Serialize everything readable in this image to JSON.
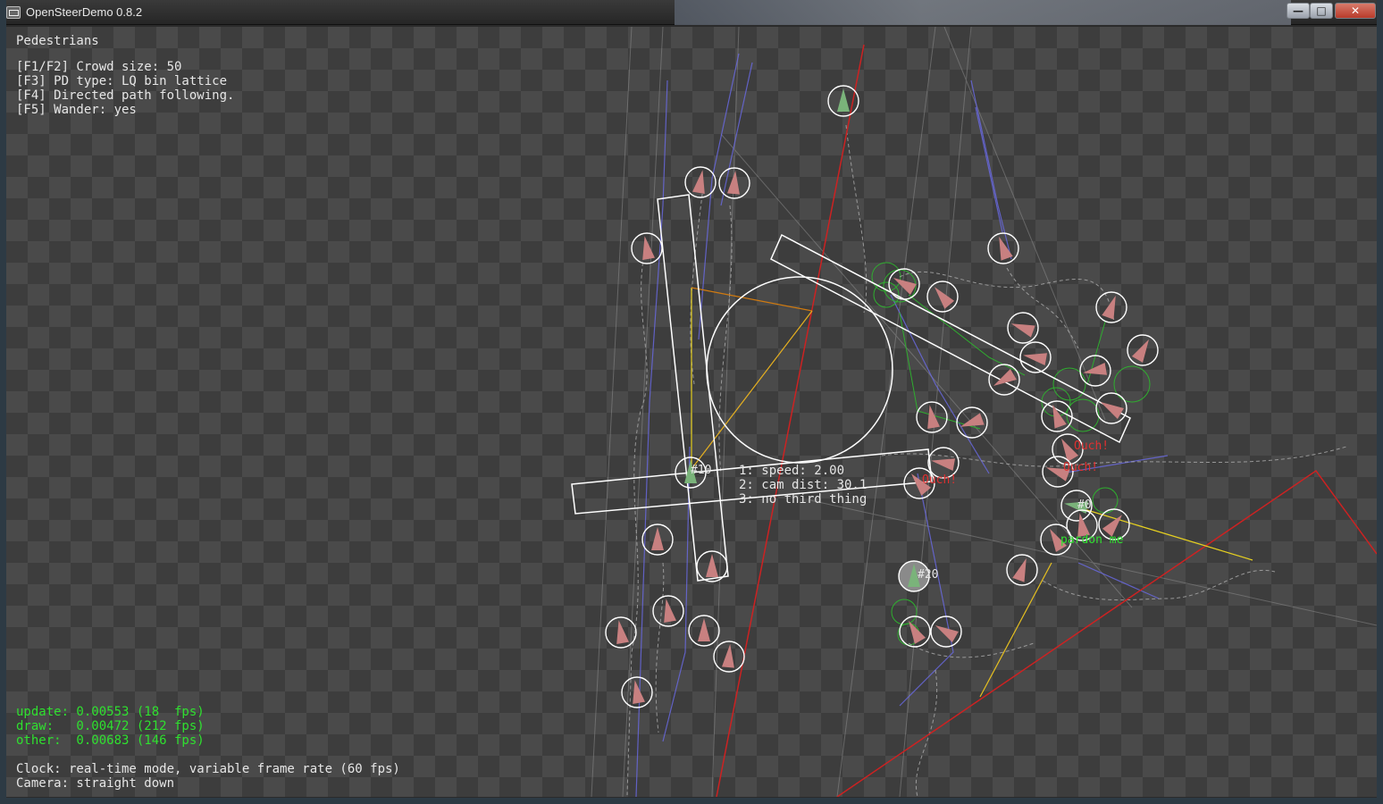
{
  "window": {
    "title": "OpenSteerDemo 0.8.2",
    "buttons": {
      "minimize": "—",
      "maximize": "□",
      "close": "✕"
    }
  },
  "hud": {
    "demo_name": "Pedestrians",
    "options": [
      "[F1/F2] Crowd size: 50",
      "[F3] PD type: LQ bin lattice",
      "[F4] Directed path following.",
      "[F5] Wander: yes"
    ],
    "timing": [
      "update: 0.00553 (18  fps)",
      "draw:   0.00472 (212 fps)",
      "other:  0.00683 (146 fps)"
    ],
    "clock": "Clock: real-time mode, variable frame rate (60 fps)",
    "camera": "Camera: straight down"
  },
  "scene": {
    "selected_info": [
      "1: speed: 2.00",
      "2: cam dist: 30.1",
      "3: no third thing"
    ],
    "agent_labels": [
      "#10",
      "#0",
      "#20"
    ],
    "messages": [
      "pardon me",
      "Ouch!",
      "Ouch!",
      "Ouch!"
    ],
    "colors": {
      "agent": "#c88080",
      "selected_agent": "#7ab37a",
      "path": "#ffffff",
      "red_line": "#cc2222",
      "yellow_line": "#e6c020",
      "blue_trail": "#6a6ae6",
      "green_trail": "#2fae2f"
    }
  }
}
